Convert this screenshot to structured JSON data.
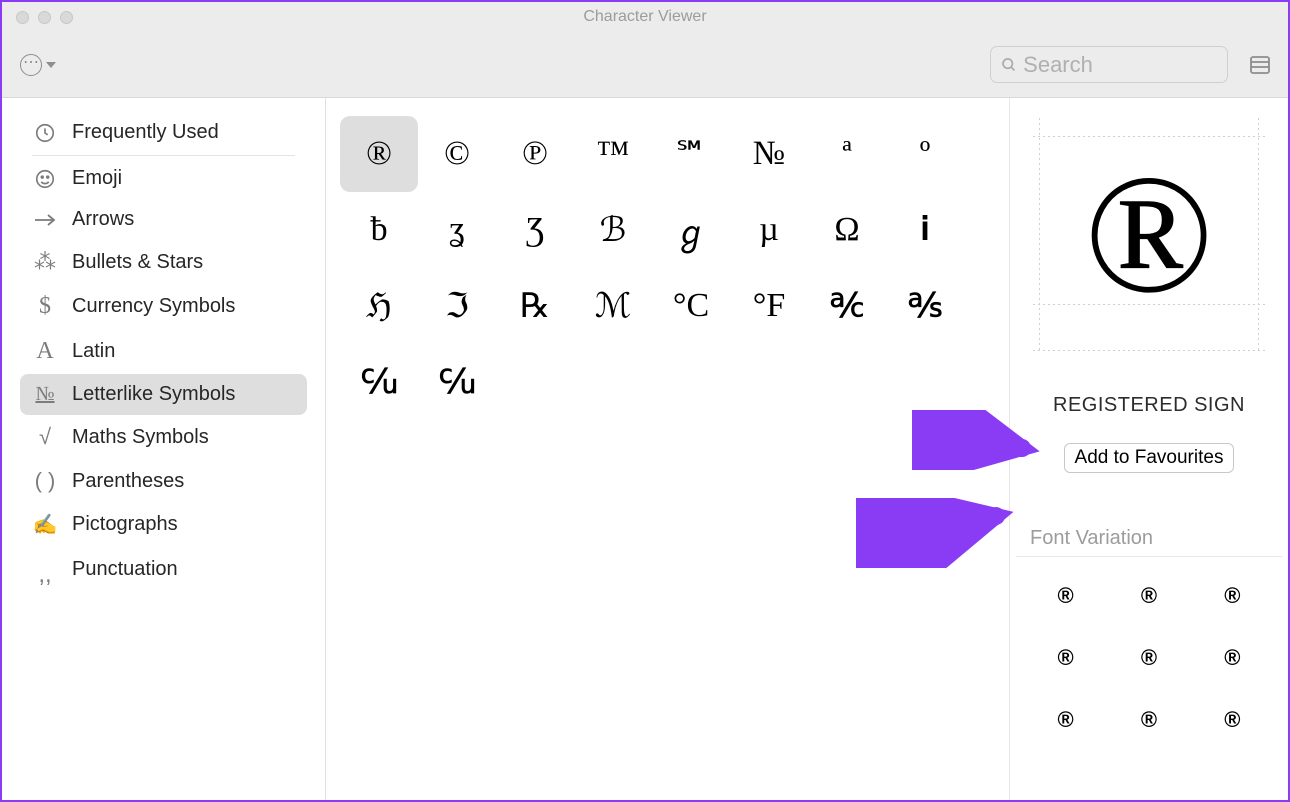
{
  "window": {
    "title": "Character Viewer"
  },
  "toolbar": {
    "search_placeholder": "Search"
  },
  "sidebar": {
    "items": [
      {
        "icon": "clock",
        "label": "Frequently Used",
        "divider_after": true
      },
      {
        "icon": "emoji",
        "label": "Emoji"
      },
      {
        "icon": "arrow",
        "label": "Arrows"
      },
      {
        "icon": "bullets",
        "label": "Bullets & Stars"
      },
      {
        "icon": "currency",
        "label": "Currency Symbols"
      },
      {
        "icon": "latin",
        "label": "Latin"
      },
      {
        "icon": "letterlike",
        "label": "Letterlike Symbols",
        "selected": true
      },
      {
        "icon": "math",
        "label": "Maths Symbols"
      },
      {
        "icon": "paren",
        "label": "Parentheses"
      },
      {
        "icon": "picto",
        "label": "Pictographs"
      },
      {
        "icon": "punct",
        "label": "Punctuation"
      }
    ]
  },
  "grid": {
    "chars": [
      "®",
      "©",
      "℗",
      "™",
      "℠",
      "№",
      "ª",
      "º",
      "ƀ",
      "ʓ",
      "Ʒ",
      "ℬ",
      "ℊ",
      "µ",
      "Ω",
      "𝐢",
      "ℌ",
      "ℑ",
      "℞",
      "ℳ",
      "°C",
      "°F",
      "℀",
      "℁",
      "℆",
      "℆"
    ],
    "selected_index": 0
  },
  "detail": {
    "preview_glyph": "®",
    "name": "REGISTERED SIGN",
    "fav_button": "Add to Favourites",
    "variation_header": "Font Variation",
    "variations": [
      "®",
      "®",
      "®",
      "®",
      "®",
      "®",
      "®",
      "®",
      "®"
    ]
  }
}
